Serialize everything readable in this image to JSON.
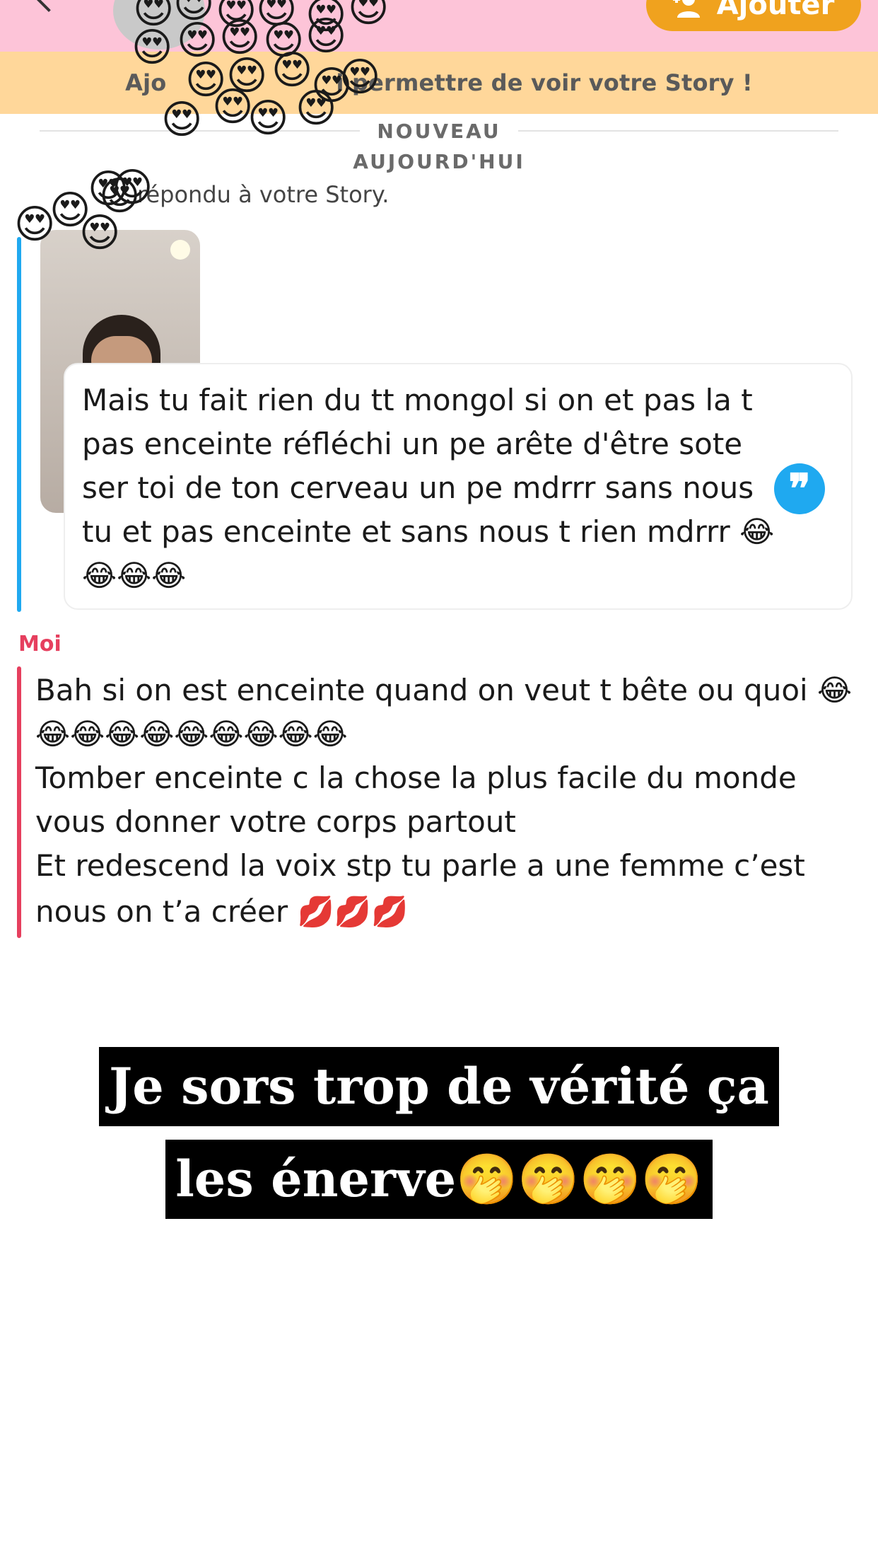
{
  "header": {
    "add_button_label": "Ajouter",
    "accent": "#f0a21e",
    "background": "#fdc4d8"
  },
  "banner": {
    "text_start": "Ajo",
    "text_end": "i permettre de voir votre Story !"
  },
  "divider": {
    "new_label": "NOUVEAU"
  },
  "day": {
    "label": "AUJOURD'HUI"
  },
  "reply": {
    "note": "répondu à votre Story."
  },
  "friend_message": {
    "lines": [
      "Mais tu fait rien du tt mongol si on et pas la t",
      "pas enceinte réfléchi un pe arête d'être sote",
      "ser toi de ton cerveau un pe mdrrr sans nous",
      "tu et pas enceinte et sans nous t rien mdrrr 😂",
      "😂😂😂"
    ],
    "badge_icon": "quote-icon",
    "accent": "#1fa9f0"
  },
  "me": {
    "sender": "Moi",
    "accent": "#e63f5e",
    "lines": [
      "Bah si on est enceinte quand on veut t bête ou quoi 😂",
      "😂😂😂😂😂😂😂😂😂",
      "Tomber enceinte c la chose la plus facile du monde",
      "vous donner votre corps partout",
      "Et redescend la voix stp tu parle a une femme c’est",
      "nous on t’a créer 💋💋💋"
    ]
  },
  "caption": {
    "line1": "Je sors trop de vérité ça",
    "line2": "les énerve🤭🤭🤭🤭"
  },
  "overlay": {
    "emoji": "😍"
  }
}
